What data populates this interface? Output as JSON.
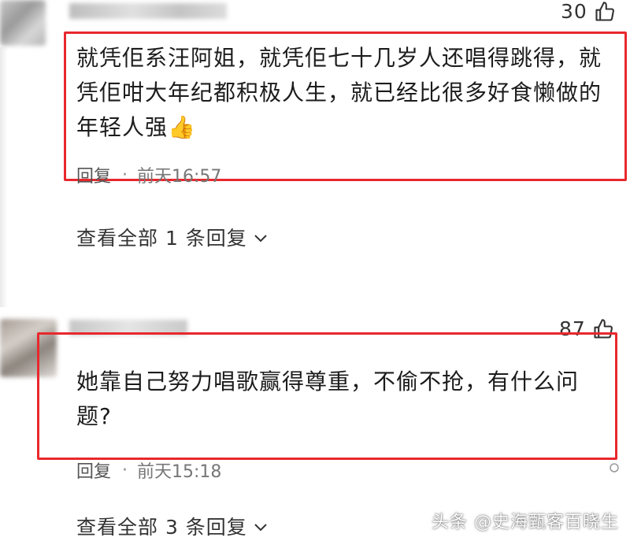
{
  "comments": [
    {
      "like_count": "30",
      "text_lines": [
        "就凭佢系汪阿姐，就凭佢七十几岁人还唱得跳得，就",
        "凭佢咁大年纪都积极人生，就已经比很多好食懒做的",
        "年轻人强👍"
      ],
      "reply_label": "回复",
      "separator": "·",
      "time": "前天16:57",
      "view_all_label": "查看全部 1 条回复"
    },
    {
      "like_count": "87",
      "text_lines": [
        "她靠自己努力唱歌赢得尊重，不偷不抢，有什么问",
        "题?"
      ],
      "reply_label": "回复",
      "separator": "·",
      "time": "前天15:18",
      "view_all_label": "查看全部 3 条回复"
    }
  ],
  "watermark": "头条 @史海甄客百晓生",
  "colors": {
    "highlight_frame": "#e8282d",
    "text": "#1c1c1c",
    "secondary_text": "#555555"
  },
  "icons": {
    "like": "thumbs-up-icon",
    "chevron": "chevron-down-icon",
    "more": "more-dots-icon"
  }
}
